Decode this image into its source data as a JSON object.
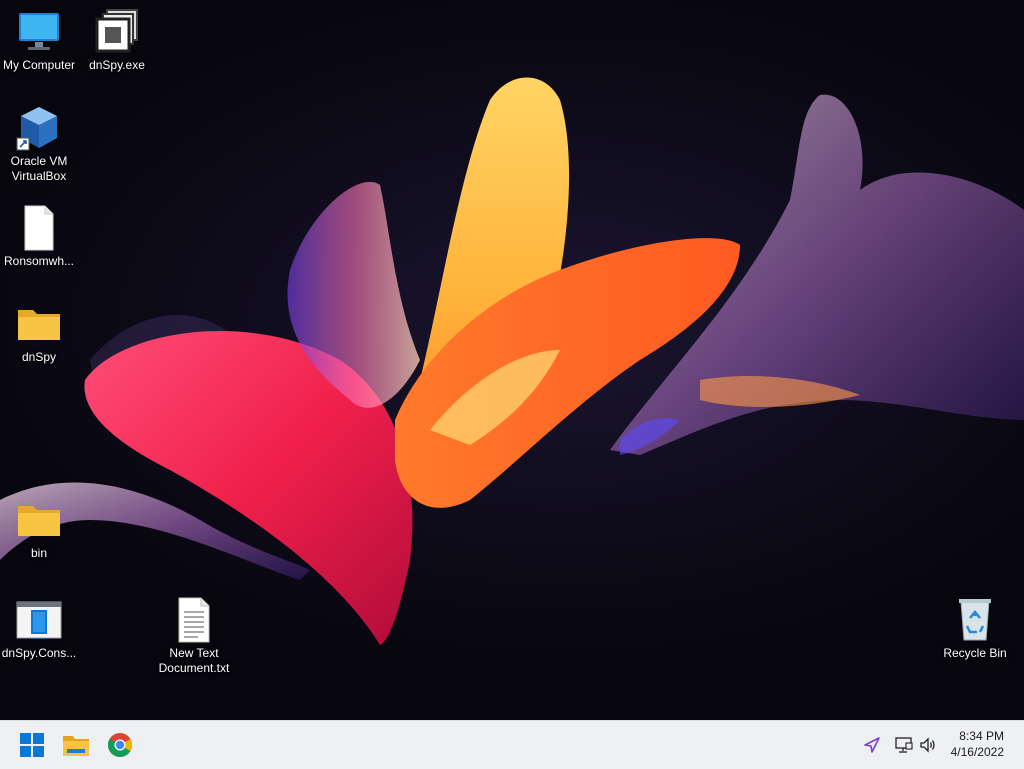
{
  "desktop": {
    "icons": [
      {
        "label": "My Computer",
        "icon": "monitor-icon"
      },
      {
        "label": "dnSpy.exe",
        "icon": "app-window-icon"
      },
      {
        "label": "Oracle VM VirtualBox",
        "icon": "virtualbox-icon"
      },
      {
        "label": "Ronsomwh...",
        "icon": "blank-file-icon"
      },
      {
        "label": "dnSpy",
        "icon": "folder-icon"
      },
      {
        "label": "bin",
        "icon": "folder-icon"
      },
      {
        "label": "dnSpy.Cons...",
        "icon": "console-app-icon"
      },
      {
        "label": "New Text Document.txt",
        "icon": "text-file-icon"
      },
      {
        "label": "Recycle Bin",
        "icon": "recycle-bin-icon"
      }
    ]
  },
  "taskbar": {
    "pinned": [
      {
        "icon": "windows-start-icon"
      },
      {
        "icon": "file-explorer-icon"
      },
      {
        "icon": "chrome-icon"
      }
    ],
    "tray": {
      "icons": [
        "location-arrow-icon",
        "network-icon",
        "volume-icon"
      ],
      "time": "8:34 PM",
      "date": "4/16/2022"
    }
  },
  "colors": {
    "taskbar_bg": "#eef0f4",
    "folder_yellow": "#f8c444",
    "accent_blue": "#0a78d4"
  }
}
